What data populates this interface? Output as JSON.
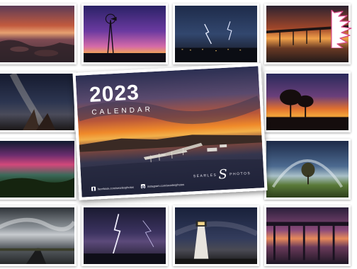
{
  "calendar": {
    "year": "2023",
    "subtitle": "CALENDAR",
    "brand_word_left": "SEARLES",
    "brand_word_right": "PHOTOS",
    "social": [
      {
        "icon": "facebook-icon",
        "text": "facebook.com/searlesphotos"
      },
      {
        "icon": "instagram-icon",
        "text": "instagram.com/searlesphotos"
      }
    ]
  },
  "tiles": [
    {
      "name": "coastal-rocks-sunset-photo",
      "scene": "coast"
    },
    {
      "name": "windmill-purple-dusk-photo",
      "scene": "windmill"
    },
    {
      "name": "lightning-storm-town-photo",
      "scene": "storm"
    },
    {
      "name": "pier-sunset-photo",
      "scene": "pier"
    },
    {
      "name": "milky-way-photo",
      "scene": "milky"
    },
    {
      "name": "trees-sunset-photo",
      "scene": "trees"
    },
    {
      "name": "aurora-australis-photo",
      "scene": "aurora"
    },
    {
      "name": "fogbow-tree-photo",
      "scene": "fogbow"
    },
    {
      "name": "storm-clouds-road-photo",
      "scene": "clouds"
    },
    {
      "name": "lightning-bolt-photo",
      "scene": "bolt"
    },
    {
      "name": "lighthouse-night-photo",
      "scene": "lighthouse"
    },
    {
      "name": "jetty-dusk-photo",
      "scene": "jetty"
    }
  ],
  "badge": {
    "color": "#ffffff",
    "accent": "#d94a8a"
  }
}
